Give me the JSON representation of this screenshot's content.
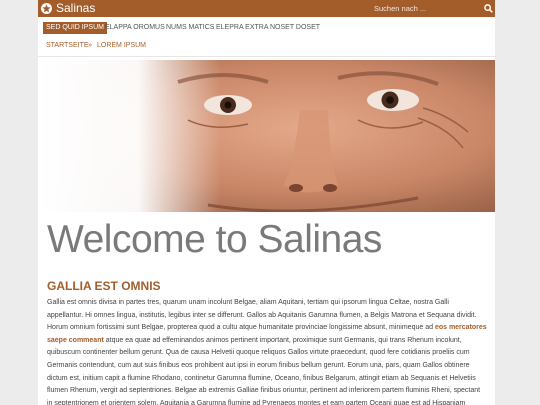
{
  "header": {
    "brand": "Salinas",
    "search_placeholder": "Suchen nach ..."
  },
  "nav": {
    "items": [
      "SED QUID IPSUM",
      "ELAPPA OROMUS",
      "NUMS MATICS",
      "ELEPRA EXTRA",
      "NOSET DOSET"
    ],
    "active_index": 0
  },
  "breadcrumb": {
    "home": "STARTSEITE",
    "separator": "»",
    "current": "LOREM IPSUM"
  },
  "main": {
    "heading": "Welcome to Salinas",
    "section_title": "GALLIA EST OMNIS",
    "paragraph_before": "Gallia est omnis divisa in partes tres, quarum unam incolunt Belgae, aliam Aquitani, tertiam qui ipsorum lingua Celtae, nostra Galli appellantur. Hi omnes lingua, institutis, legibus inter se differunt. Gallos ab Aquitanis Garumna flumen, a Belgis Matrona et Sequana dividit. Horum omnium fortissimi sunt Belgae, propterea quod a cultu atque humanitate provinciae longissime absunt, minimeque ad",
    "paragraph_link": "eos mercatores saepe commeant",
    "paragraph_after": "atque ea quae ad effeminandos animos pertinent important, proximique sunt Germanis, qui trans Rhenum incolunt, quibuscum continenter bellum gerunt. Qua de causa Helvetii quoque reliquos Gallos virtute praecedunt, quod fere cotidianis proeliis cum Germanis contendunt, cum aut suis finibus eos prohibent aut ipsi in eorum finibus bellum gerunt. Eorum una, pars, quam Gallos obtinere dictum est, initium capit a flumine Rhodano, continetur Garumna flumine, Oceano, finibus Belgarum, attingit etiam ab Sequanis et Helvetiis flumen Rhenum, vergit ad septentriones. Belgae ab extremis Galliae finibus oriuntur, pertinent ad inferiorem partem fluminis Rheni, spectant in septentrionem et orientem solem. Aquitania a Garumna flumine ad Pyrenaeos montes et eam partem Oceani quae est ad Hispaniam pertinet; spectat inter occasum solis et septentriones."
  },
  "colors": {
    "accent": "#a35d2a",
    "heading": "#7a7a7a",
    "text": "#444444",
    "background": "#ececec"
  },
  "icons": {
    "logo": "star-badge-icon",
    "search": "search-icon"
  }
}
